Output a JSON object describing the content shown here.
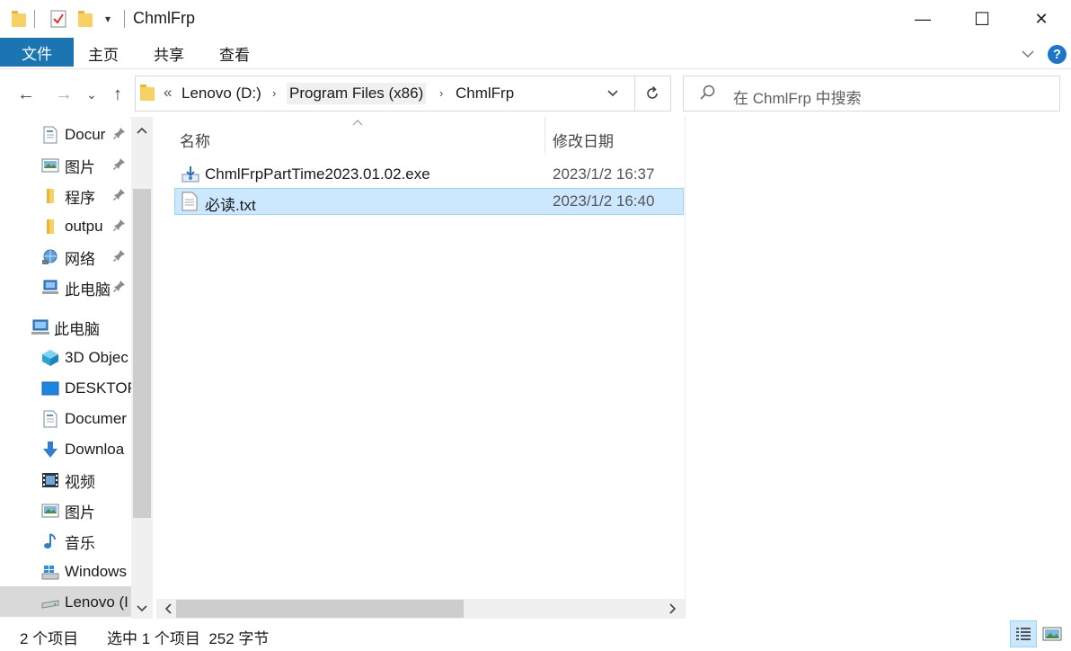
{
  "window": {
    "title": "ChmlFrp",
    "minimize": "—",
    "maximize": "☐",
    "close": "✕"
  },
  "ribbon": {
    "tabs": [
      "文件",
      "主页",
      "共享",
      "查看"
    ],
    "help": "?"
  },
  "nav": {
    "back": "←",
    "forward": "→",
    "recent": "⌄",
    "up": "↑"
  },
  "address": {
    "overflow": "«",
    "crumbs": [
      "Lenovo (D:)",
      "Program Files (x86)",
      "ChmlFrp"
    ],
    "separator": "›"
  },
  "search": {
    "placeholder": "在 ChmlFrp 中搜索"
  },
  "sidebar": {
    "quick_access": [
      {
        "label": "Docur",
        "icon": "document-icon"
      },
      {
        "label": "图片",
        "icon": "picture-icon"
      },
      {
        "label": "程序",
        "icon": "folder-icon"
      },
      {
        "label": "outpu",
        "icon": "folder-icon"
      },
      {
        "label": "网络",
        "icon": "network-icon"
      },
      {
        "label": "此电脑",
        "icon": "computer-icon"
      }
    ],
    "this_pc_label": "此电脑",
    "this_pc_items": [
      {
        "label": "3D Objec",
        "icon": "3d-objects-icon"
      },
      {
        "label": "DESKTOP",
        "icon": "desktop-icon"
      },
      {
        "label": "Documer",
        "icon": "document-icon"
      },
      {
        "label": "Downloa",
        "icon": "download-icon"
      },
      {
        "label": "视频",
        "icon": "video-icon"
      },
      {
        "label": "图片",
        "icon": "picture-icon"
      },
      {
        "label": "音乐",
        "icon": "music-icon"
      },
      {
        "label": "Windows",
        "icon": "windows-drive-icon"
      },
      {
        "label": "Lenovo (I",
        "icon": "drive-icon"
      }
    ]
  },
  "file_list": {
    "columns": [
      "名称",
      "修改日期"
    ],
    "files": [
      {
        "name": "ChmlFrpPartTime2023.01.02.exe",
        "date": "2023/1/2 16:37",
        "icon": "installer-icon",
        "selected": false
      },
      {
        "name": "必读.txt",
        "date": "2023/1/2 16:40",
        "icon": "text-file-icon",
        "selected": true
      }
    ]
  },
  "status": {
    "count": "2 个项目",
    "selection": "选中 1 个项目  252 字节"
  },
  "colors": {
    "accent": "#1b75b3",
    "selection": "#cce8ff",
    "folder": "#f8d165"
  }
}
